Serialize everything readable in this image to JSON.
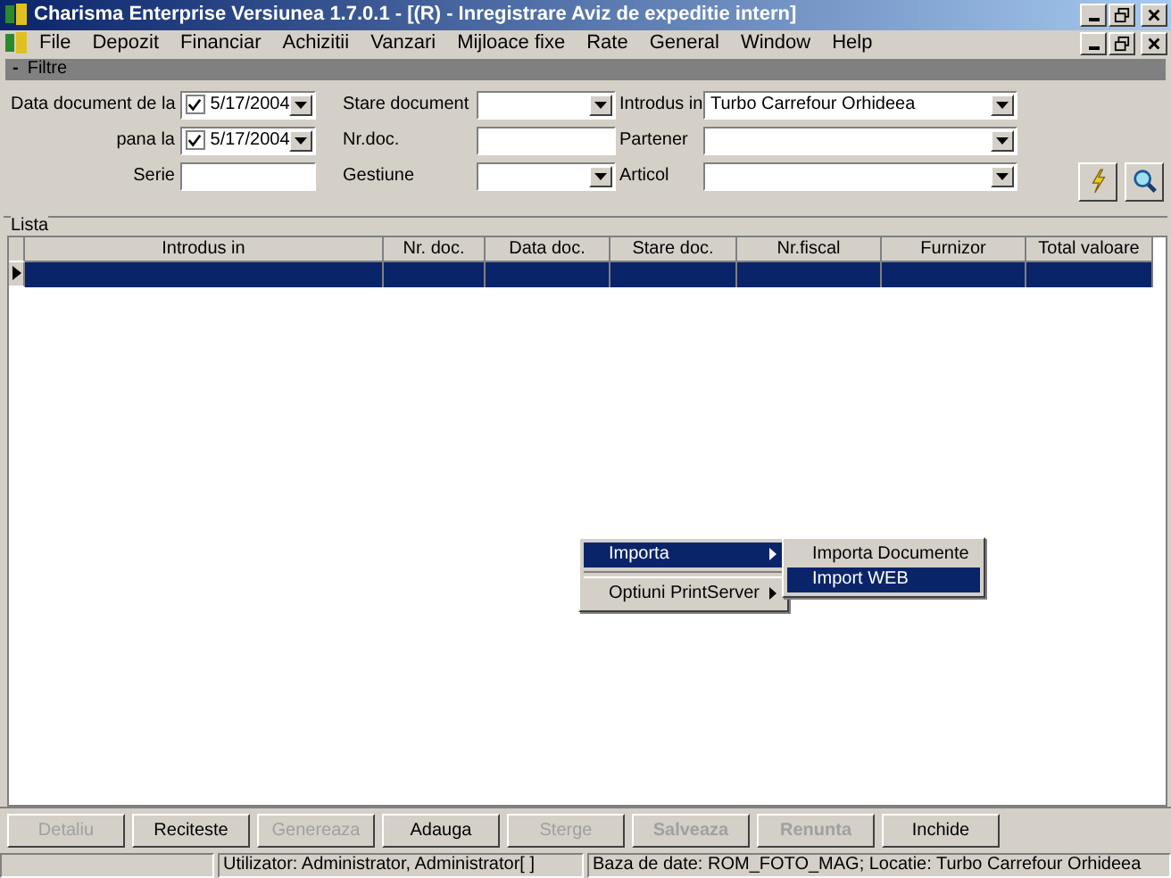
{
  "window": {
    "title": "Charisma Enterprise Versiunea 1.7.0.1 - [(R) - Inregistrare Aviz de expeditie intern]"
  },
  "menu": [
    "File",
    "Depozit",
    "Financiar",
    "Achizitii",
    "Vanzari",
    "Mijloace fixe",
    "Rate",
    "General",
    "Window",
    "Help"
  ],
  "filter_panel": {
    "toggle": "-",
    "title": "Filtre",
    "rows": [
      [
        {
          "label": "Data document  de la",
          "kind": "date",
          "checked": true,
          "value": "5/17/2004"
        },
        {
          "label": "Stare document",
          "kind": "dropdown"
        },
        {
          "label": "Introdus in",
          "kind": "dropdown",
          "value": "Turbo Carrefour Orhideea"
        }
      ],
      [
        {
          "label": "pana la",
          "kind": "date",
          "checked": true,
          "value": "5/17/2004"
        },
        {
          "label": "Nr.doc.",
          "kind": "text"
        },
        {
          "label": "Partener",
          "kind": "dropdown"
        }
      ],
      [
        {
          "label": "Serie",
          "kind": "text"
        },
        {
          "label": "Gestiune",
          "kind": "dropdown"
        },
        {
          "label": "Articol",
          "kind": "dropdown"
        }
      ]
    ]
  },
  "list": {
    "title": "Lista",
    "columns": [
      "Introdus in",
      "Nr. doc.",
      "Data doc.",
      "Stare doc.",
      "Nr.fiscal",
      "Furnizor",
      "Total valoare"
    ],
    "rows": [
      {
        "selected": true
      }
    ]
  },
  "context_menu": {
    "items": [
      {
        "label": "Importa",
        "selected": true,
        "submenu": true
      },
      {
        "label": "Optiuni PrintServer",
        "selected": false,
        "submenu": true
      }
    ],
    "submenu": [
      {
        "label": "Importa Documente",
        "selected": false
      },
      {
        "label": "Import WEB",
        "selected": true
      }
    ]
  },
  "buttons": [
    {
      "label": "Detaliu",
      "disabled": true
    },
    {
      "label": "Reciteste",
      "disabled": false
    },
    {
      "label": "Genereaza",
      "disabled": true
    },
    {
      "label": "Adauga",
      "disabled": false
    },
    {
      "label": "Sterge",
      "disabled": true
    },
    {
      "label": "Salveaza",
      "disabled": true
    },
    {
      "label": "Renunta",
      "disabled": true
    },
    {
      "label": "Inchide",
      "disabled": false
    }
  ],
  "status_bar": [
    "Utilizator: Administrator, Administrator[ ]",
    "Baza de date: ROM_FOTO_MAG; Locatie: Turbo Carrefour Orhideea"
  ]
}
